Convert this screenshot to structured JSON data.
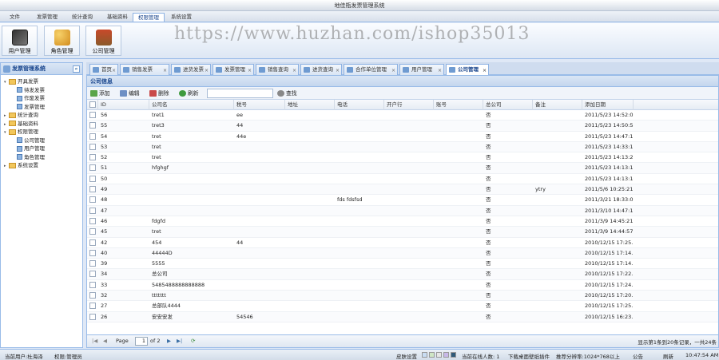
{
  "app": {
    "title": "地佳瓶发票管理系统"
  },
  "menu": {
    "items": [
      "文件",
      "发票管理",
      "统计查询",
      "基础资料",
      "权限管理",
      "系统设置"
    ],
    "active": 4
  },
  "toolbar": {
    "buttons": [
      {
        "label": "用户管理",
        "icon": "user-icon"
      },
      {
        "label": "角色管理",
        "icon": "role-icon"
      },
      {
        "label": "公司管理",
        "icon": "company-icon"
      }
    ]
  },
  "watermark": "https://www.huzhan.com/ishop35013",
  "left": {
    "title": "发票管理系统",
    "tree": [
      {
        "label": "开具发票",
        "level": 0,
        "type": "folder",
        "expanded": true
      },
      {
        "label": "待发发票",
        "level": 1,
        "type": "leaf"
      },
      {
        "label": "作废发票",
        "level": 1,
        "type": "leaf"
      },
      {
        "label": "发票管理",
        "level": 1,
        "type": "leaf"
      },
      {
        "label": "统计查询",
        "level": 0,
        "type": "folder",
        "expanded": false
      },
      {
        "label": "基础资料",
        "level": 0,
        "type": "folder",
        "expanded": false
      },
      {
        "label": "权限管理",
        "level": 0,
        "type": "folder",
        "expanded": true
      },
      {
        "label": "公司管理",
        "level": 1,
        "type": "leaf"
      },
      {
        "label": "用户管理",
        "level": 1,
        "type": "leaf"
      },
      {
        "label": "角色管理",
        "level": 1,
        "type": "leaf"
      },
      {
        "label": "系统设置",
        "level": 0,
        "type": "folder",
        "expanded": false
      }
    ]
  },
  "tabs": [
    "首页",
    "销售发票",
    "进货发票",
    "发票管理",
    "销售查询",
    "进货查询",
    "合作单位管理",
    "用户管理",
    "公司管理"
  ],
  "grid": {
    "title": "公司信息",
    "actions": {
      "add": "添加",
      "edit": "编辑",
      "delete": "删除",
      "refresh": "刷新",
      "search": "查找"
    },
    "columns": [
      "ID",
      "公司名",
      "税号",
      "地址",
      "电话",
      "开户行",
      "账号",
      "总公司",
      "备注",
      "添加日期"
    ],
    "rows": [
      [
        "56",
        "tret1",
        "ee",
        "",
        "",
        "",
        "",
        "否",
        "",
        "2011/5/23 14:52:02"
      ],
      [
        "55",
        "tret3",
        "44",
        "",
        "",
        "",
        "",
        "否",
        "",
        "2011/5/23 14:50:58"
      ],
      [
        "54",
        "tret",
        "44e",
        "",
        "",
        "",
        "",
        "否",
        "",
        "2011/5/23 14:47:11"
      ],
      [
        "53",
        "tret",
        "",
        "",
        "",
        "",
        "",
        "否",
        "",
        "2011/5/23 14:33:17"
      ],
      [
        "52",
        "tret",
        "",
        "",
        "",
        "",
        "",
        "否",
        "",
        "2011/5/23 14:13:23"
      ],
      [
        "51",
        "hfghgf",
        "",
        "",
        "",
        "",
        "",
        "否",
        "",
        "2011/5/23 14:13:16"
      ],
      [
        "50",
        "",
        "",
        "",
        "",
        "",
        "",
        "否",
        "",
        "2011/5/23 14:13:10"
      ],
      [
        "49",
        "",
        "",
        "",
        "",
        "",
        "",
        "否",
        "ytry",
        "2011/5/6 10:25:21"
      ],
      [
        "48",
        "",
        "",
        "",
        "fds fdsfsd",
        "",
        "",
        "否",
        "",
        "2011/3/21 18:33:03"
      ],
      [
        "47",
        "",
        "",
        "",
        "",
        "",
        "",
        "否",
        "",
        "2011/3/10 14:47:13"
      ],
      [
        "46",
        "fdgfd",
        "",
        "",
        "",
        "",
        "",
        "否",
        "",
        "2011/3/9 14:45:21"
      ],
      [
        "45",
        "tret",
        "",
        "",
        "",
        "",
        "",
        "否",
        "",
        "2011/3/9 14:44:57"
      ],
      [
        "42",
        "454",
        "44",
        "",
        "",
        "",
        "",
        "否",
        "",
        "2010/12/15 17:25..."
      ],
      [
        "40",
        "44444D",
        "",
        "",
        "",
        "",
        "",
        "否",
        "",
        "2010/12/15 17:14..."
      ],
      [
        "39",
        "5555",
        "",
        "",
        "",
        "",
        "",
        "否",
        "",
        "2010/12/15 17:14..."
      ],
      [
        "34",
        "总公司",
        "",
        "",
        "",
        "",
        "",
        "否",
        "",
        "2010/12/15 17:22..."
      ],
      [
        "33",
        "5485488888888888",
        "",
        "",
        "",
        "",
        "",
        "否",
        "",
        "2010/12/15 17:24..."
      ],
      [
        "32",
        "ttttttt",
        "",
        "",
        "",
        "",
        "",
        "否",
        "",
        "2010/12/15 17:20..."
      ],
      [
        "27",
        "总部队4444",
        "",
        "",
        "",
        "",
        "",
        "否",
        "",
        "2010/12/15 17:25..."
      ],
      [
        "26",
        "安安安发",
        "54546",
        "",
        "",
        "",
        "",
        "否",
        "",
        "2010/12/15 16:23..."
      ]
    ]
  },
  "pager": {
    "page_label": "Page",
    "page": "1",
    "of": "of 2",
    "summary": "显示第1条到20条记录，一共24条"
  },
  "status": {
    "user": "当前用户:杜海泽",
    "role": "权限:管理员",
    "skin": "皮肤设置",
    "online": "当前在线人数: 1",
    "download": "下载桌面壁纸插件",
    "resolution": "推荐分辨率:1024*768以上",
    "notice": "公告",
    "refresh": "刷新",
    "time": "10:47:54 AM",
    "swatches": [
      "#c9ddf3",
      "#cfe6c5",
      "#e6e6e6",
      "#c7b8e8",
      "#2f5a7a"
    ]
  }
}
